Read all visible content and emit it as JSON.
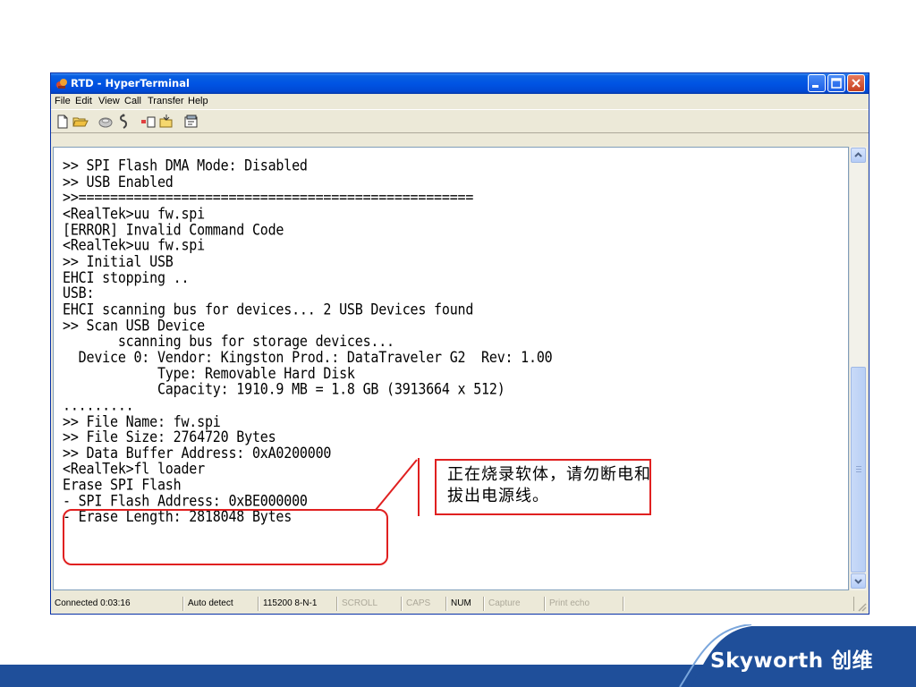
{
  "window": {
    "title": "RTD - HyperTerminal",
    "accent": "#0054e3"
  },
  "menu": {
    "items": [
      {
        "label": "File"
      },
      {
        "label": "Edit"
      },
      {
        "label": "View"
      },
      {
        "label": "Call"
      },
      {
        "label": "Transfer"
      },
      {
        "label": "Help"
      }
    ]
  },
  "toolbar": {
    "icons": [
      "new-connection-icon",
      "open-icon",
      "connect-icon",
      "disconnect-icon",
      "send-file-icon",
      "receive-file-icon",
      "properties-icon"
    ]
  },
  "terminal": {
    "lines": [
      ">> SPI Flash DMA Mode: Disabled",
      ">> USB Enabled",
      ">>==================================================",
      "<RealTek>uu fw.spi",
      "[ERROR] Invalid Command Code",
      "<RealTek>uu fw.spi",
      ">> Initial USB",
      "EHCI stopping ..",
      "USB:",
      "EHCI scanning bus for devices... 2 USB Devices found",
      ">> Scan USB Device",
      "       scanning bus for storage devices...",
      "  Device 0: Vendor: Kingston Prod.: DataTraveler G2  Rev: 1.00",
      "            Type: Removable Hard Disk",
      "            Capacity: 1910.9 MB = 1.8 GB (3913664 x 512)",
      ".........",
      ">> File Name: fw.spi",
      ">> File Size: 2764720 Bytes",
      ">> Data Buffer Address: 0xA0200000",
      "<RealTek>fl loader",
      "Erase SPI Flash",
      "- SPI Flash Address: 0xBE000000",
      "- Erase Length: 2818048 Bytes"
    ]
  },
  "statusbar": {
    "connected": "Connected 0:03:16",
    "detect": "Auto detect",
    "settings": "115200 8-N-1",
    "scroll": "SCROLL",
    "caps": "CAPS",
    "num": "NUM",
    "capture": "Capture",
    "print_echo": "Print echo"
  },
  "annotation": {
    "note": "正在烧录软体，请勿断电和拔出电源线。",
    "color": "#e02020"
  },
  "brand": {
    "logo_text": "Skyworth 创维",
    "band_color": "#1f4f9a"
  }
}
